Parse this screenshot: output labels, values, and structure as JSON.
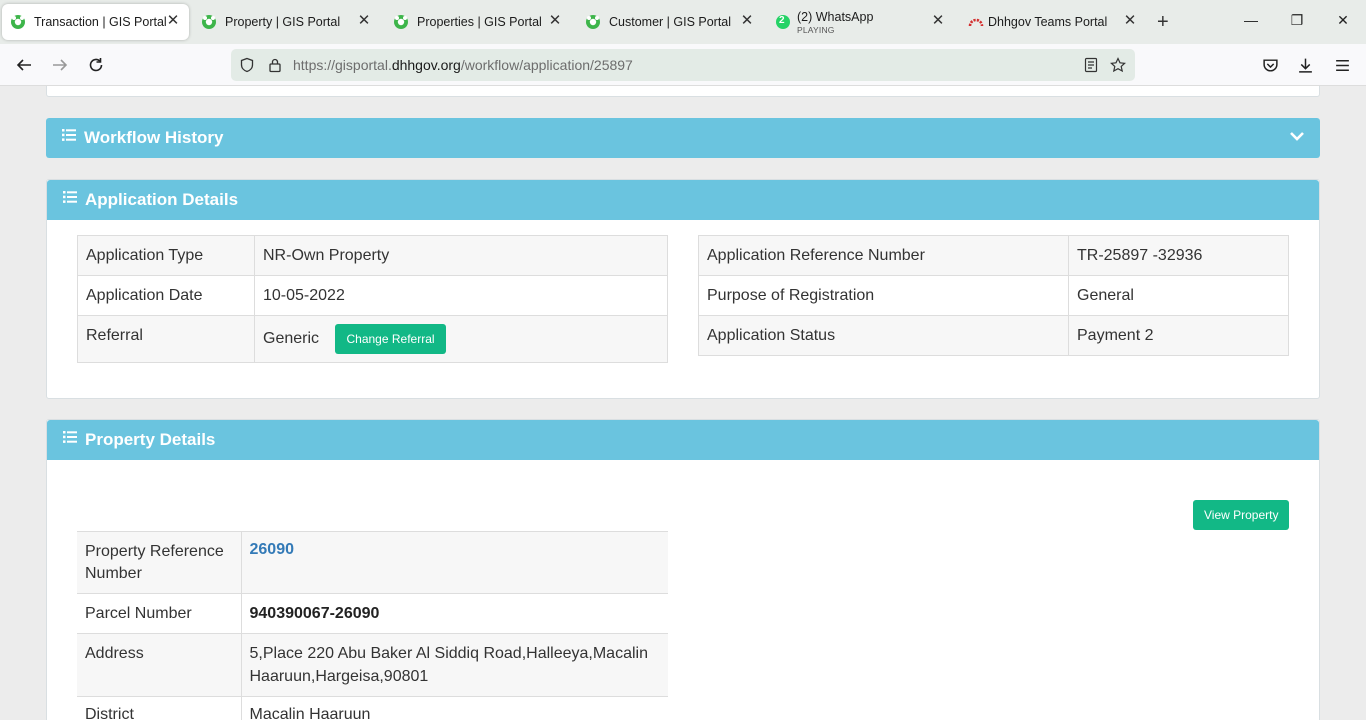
{
  "browser": {
    "tabs": [
      {
        "label": "Transaction | GIS Portal",
        "icon": "gis-portal-icon",
        "active": true
      },
      {
        "label": "Property | GIS Portal",
        "icon": "gis-portal-icon"
      },
      {
        "label": "Properties | GIS Portal",
        "icon": "gis-portal-icon"
      },
      {
        "label": "Customer | GIS Portal",
        "icon": "gis-portal-icon"
      },
      {
        "label": "(2) WhatsApp",
        "sublabel": "PLAYING",
        "icon": "whatsapp-icon",
        "badge": "2"
      },
      {
        "label": "Dhhgov Teams Portal",
        "icon": "teams-portal-icon"
      }
    ],
    "url_prefix": "https://gisportal.",
    "url_domain": "dhhgov.org",
    "url_path": "/workflow/application/25897"
  },
  "workflow_history": {
    "title": "Workflow History"
  },
  "application_details": {
    "title": "Application Details",
    "left": [
      {
        "label": "Application Type",
        "value": "NR-Own Property"
      },
      {
        "label": "Application Date",
        "value": "10-05-2022"
      },
      {
        "label": "Referral",
        "value": "Generic",
        "button": "Change Referral"
      }
    ],
    "right": [
      {
        "label": "Application Reference Number",
        "value": "TR-25897 -32936"
      },
      {
        "label": "Purpose of Registration",
        "value": "General"
      },
      {
        "label": "Application Status",
        "value": "Payment 2"
      }
    ]
  },
  "property_details": {
    "title": "Property Details",
    "view_button": "View Property",
    "rows": [
      {
        "label": "Property Reference Number",
        "value": "26090"
      },
      {
        "label": "Parcel Number",
        "value": "940390067-26090"
      },
      {
        "label": "Address",
        "value": "5,Place 220 Abu Baker Al Siddiq Road,Halleeya,Macalin Haaruun,Hargeisa,90801"
      },
      {
        "label": "District",
        "value": "Macalin Haaruun"
      }
    ]
  },
  "colors": {
    "panel_header": "#6ac4df",
    "button_green": "#12b886",
    "link_blue": "#337ab7"
  }
}
